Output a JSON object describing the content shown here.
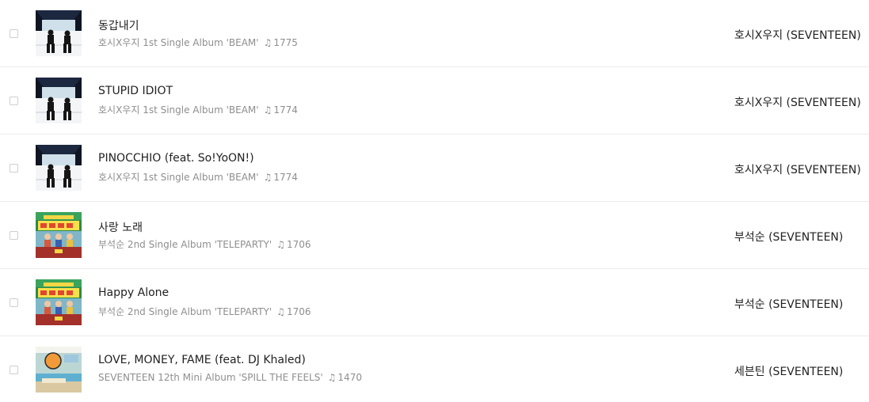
{
  "tracks": [
    {
      "title": "동갑내기",
      "album": "호시X우지 1st Single Album 'BEAM'",
      "count": "1775",
      "artist": "호시X우지 (SEVENTEEN)",
      "art_icon": "beam-album-art"
    },
    {
      "title": "STUPID IDIOT",
      "album": "호시X우지 1st Single Album 'BEAM'",
      "count": "1774",
      "artist": "호시X우지 (SEVENTEEN)",
      "art_icon": "beam-album-art"
    },
    {
      "title": "PINOCCHIO (feat. So!YoON!)",
      "album": "호시X우지 1st Single Album 'BEAM'",
      "count": "1774",
      "artist": "호시X우지 (SEVENTEEN)",
      "art_icon": "beam-album-art"
    },
    {
      "title": "사랑 노래",
      "album": "부석순 2nd Single Album 'TELEPARTY'",
      "count": "1706",
      "artist": "부석순 (SEVENTEEN)",
      "art_icon": "teleparty-album-art"
    },
    {
      "title": "Happy Alone",
      "album": "부석순 2nd Single Album 'TELEPARTY'",
      "count": "1706",
      "artist": "부석순 (SEVENTEEN)",
      "art_icon": "teleparty-album-art"
    },
    {
      "title": "LOVE, MONEY, FAME (feat. DJ Khaled)",
      "album": "SEVENTEEN 12th Mini Album 'SPILL THE FEELS'",
      "count": "1470",
      "artist": "세븐틴 (SEVENTEEN)",
      "art_icon": "spill-the-feels-album-art"
    }
  ],
  "icons": {
    "note": "♫",
    "note_icon_name": "music-note-icon",
    "checkbox_icon_name": "checkbox-icon"
  },
  "colors": {
    "title": "#222222",
    "subtitle": "#8e8e8e",
    "divider": "#ececec",
    "teleparty_bg": "#2c8a4a",
    "beam_bg": "#0f1522"
  }
}
